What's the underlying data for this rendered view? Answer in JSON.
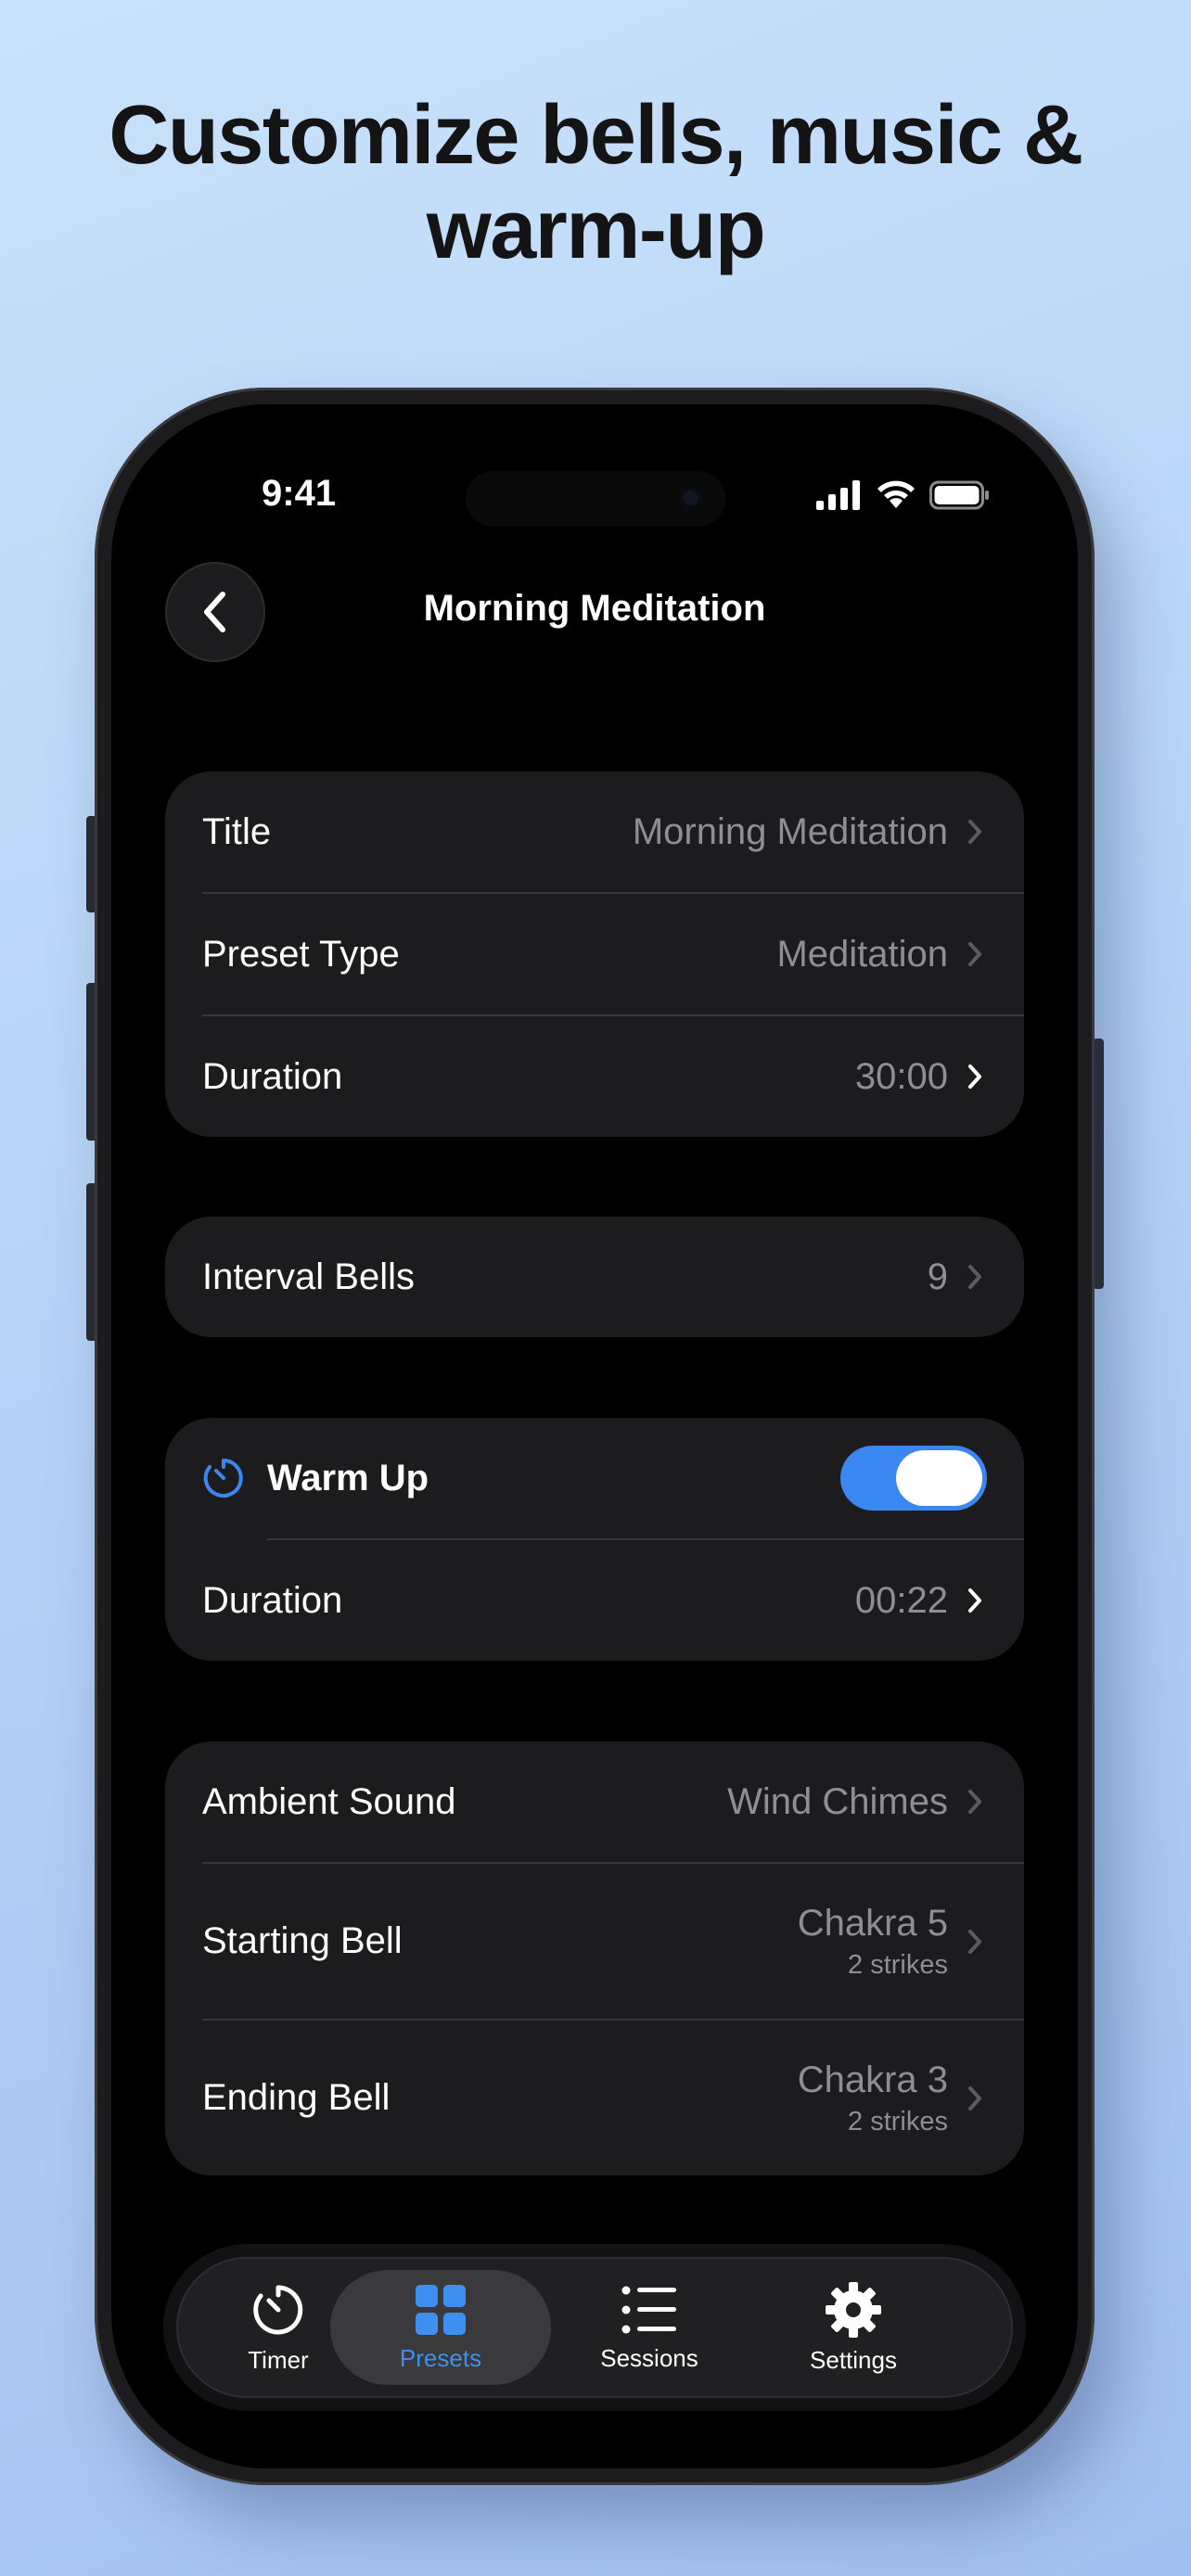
{
  "headline": "Customize bells, music &\nwarm-up",
  "status_bar": {
    "time": "9:41"
  },
  "nav": {
    "title": "Morning Meditation"
  },
  "general": {
    "title_label": "Title",
    "title_value": "Morning Meditation",
    "type_label": "Preset Type",
    "type_value": "Meditation",
    "duration_label": "Duration",
    "duration_value": "30:00"
  },
  "interval_bells": {
    "label": "Interval Bells",
    "value": "9"
  },
  "warm_up": {
    "label": "Warm Up",
    "enabled": true,
    "duration_label": "Duration",
    "duration_value": "00:22"
  },
  "sounds": {
    "ambient_label": "Ambient Sound",
    "ambient_value": "Wind Chimes",
    "start_label": "Starting Bell",
    "start_value": "Chakra 5",
    "start_sub": "2 strikes",
    "end_label": "Ending Bell",
    "end_value": "Chakra 3",
    "end_sub": "2 strikes"
  },
  "tabs": [
    {
      "label": "Timer",
      "icon": "timer-icon",
      "active": false
    },
    {
      "label": "Presets",
      "icon": "grid-icon",
      "active": true
    },
    {
      "label": "Sessions",
      "icon": "list-icon",
      "active": false
    },
    {
      "label": "Settings",
      "icon": "gear-icon",
      "active": false
    }
  ],
  "colors": {
    "accent": "#3b87f1",
    "background": "#000000",
    "card": "#1c1c1e",
    "secondary_text": "#8e8e93"
  }
}
